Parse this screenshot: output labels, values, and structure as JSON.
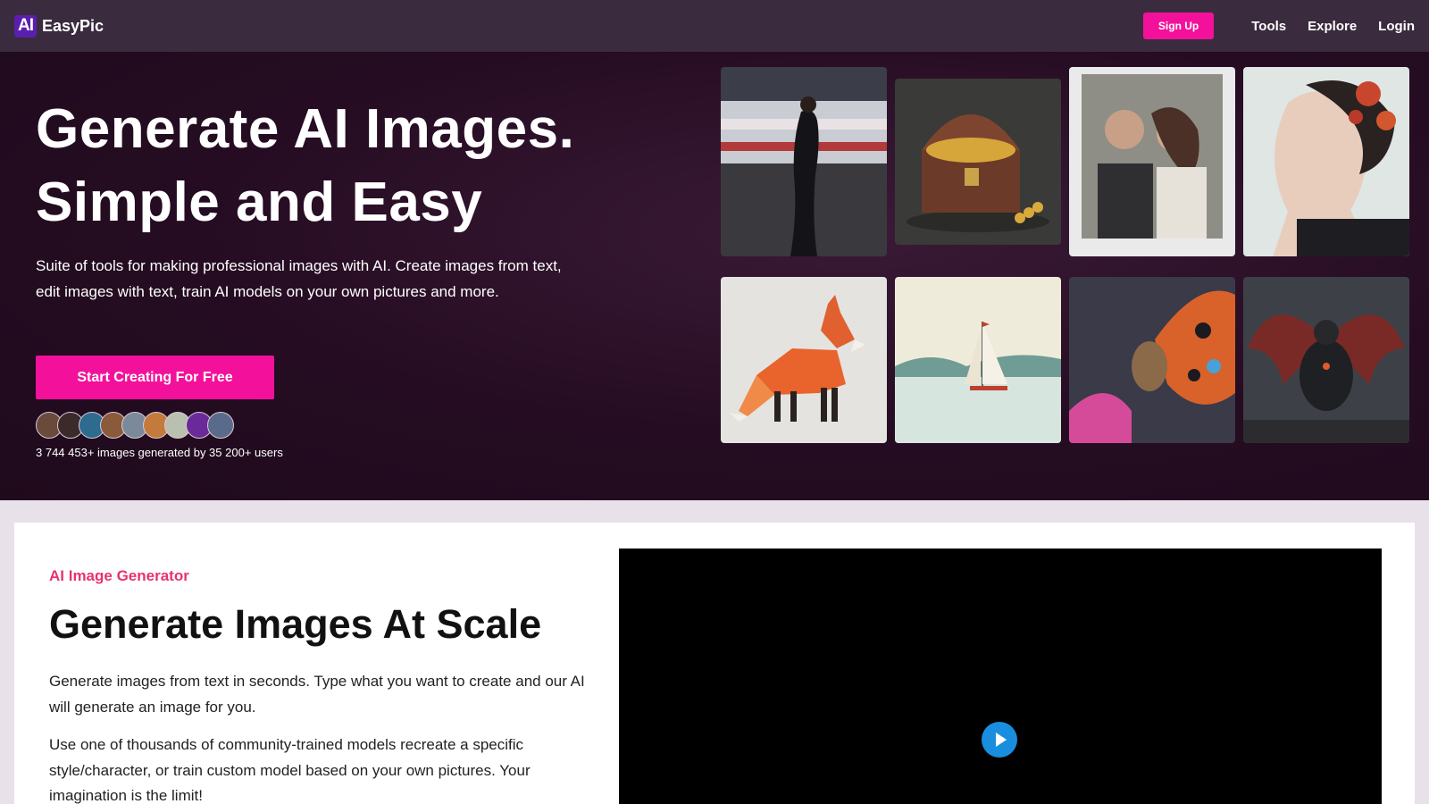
{
  "nav": {
    "logo_badge": "AI",
    "logo_text": "EasyPic",
    "signup_label": "Sign Up",
    "links": [
      "Tools",
      "Explore",
      "Login"
    ]
  },
  "hero": {
    "title_line1": "Generate AI Images.",
    "title_line2": "Simple and Easy",
    "subtitle": "Suite of tools for making professional images with AI. Create images from text, edit images with text, train AI models on your own pictures and more.",
    "cta_label": "Start Creating For Free",
    "stats": "3 744 453+ images generated by 35 200+ users",
    "gallery": [
      "woman-walking-street",
      "treasure-chest",
      "couple-polaroid",
      "woman-roses-portrait",
      "lowpoly-fox",
      "sailboat-lake",
      "butterfly-insect",
      "dark-dragon"
    ]
  },
  "section": {
    "kicker": "AI Image Generator",
    "title": "Generate Images At Scale",
    "para1": "Generate images from text in seconds. Type what you want to create and our AI will generate an image for you.",
    "para2": "Use one of thousands of community-trained models recreate a specific style/character, or train custom model based on your own pictures. Your imagination is the limit!"
  },
  "colors": {
    "accent": "#f3119b",
    "kicker": "#e8336c",
    "nav_bg": "#3b2b3f",
    "hero_bg": "#250c22",
    "play": "#1a8ede"
  }
}
